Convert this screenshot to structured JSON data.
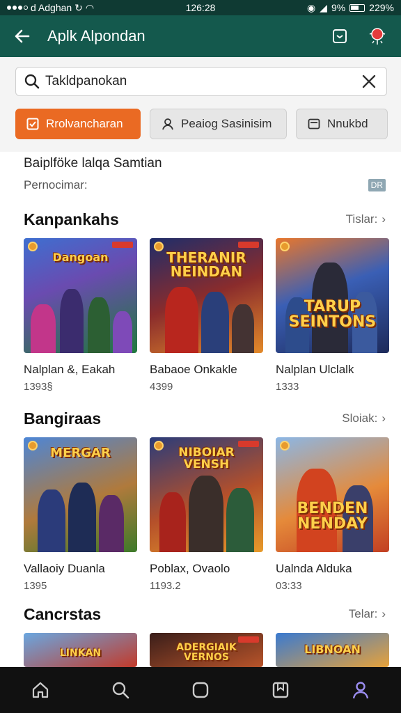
{
  "status": {
    "carrier": "d Adghan",
    "time": "126:28",
    "signal_pct": "9%",
    "battery": "229%"
  },
  "app_bar": {
    "title": "Aplk Alpondan"
  },
  "search": {
    "value": "Takldpanokan",
    "placeholder": ""
  },
  "chips": [
    {
      "label": "Rrolvancharan",
      "active": true
    },
    {
      "label": "Peaiog Sasinisim",
      "active": false
    },
    {
      "label": "Nnukbd",
      "active": false
    }
  ],
  "info": {
    "line1": "Baiplföke lalqa Samtian",
    "line2": "Pernocimar:",
    "badge": "DR"
  },
  "sections": [
    {
      "title": "Kanpankahs",
      "see_all": "Tislar:",
      "cards": [
        {
          "title": "Nalplan &, Eakah",
          "sub": "1393§",
          "art": "Dangoan"
        },
        {
          "title": "Babaoe Onkakle",
          "sub": "4399",
          "art": "THERANIR NEINDAN"
        },
        {
          "title": "Nalplan Ulclalk",
          "sub": "1333",
          "art": "TARUP SEINTONS"
        }
      ]
    },
    {
      "title": "Bangiraas",
      "see_all": "Sloiak:",
      "cards": [
        {
          "title": "Vallaoiy Duanla",
          "sub": "1395",
          "art": "MERGAR"
        },
        {
          "title": "Poblax, Ovaolo",
          "sub": "1193.2",
          "art": "NIBOIAR VENSH"
        },
        {
          "title": "Ualnda Alduka",
          "sub": "03:33",
          "art": "BENDEN NENDAY"
        }
      ]
    },
    {
      "title": "Cancrstas",
      "see_all": "Telar:",
      "cards": [
        {
          "title": "",
          "sub": "",
          "art": "LINKAN"
        },
        {
          "title": "",
          "sub": "",
          "art": "ADERGIAIK VERNOS"
        },
        {
          "title": "",
          "sub": "",
          "art": "LIBNOAN"
        }
      ]
    }
  ],
  "colors": {
    "app_bar": "#14594d",
    "accent": "#ea6a23",
    "nav_bar": "#111111"
  }
}
